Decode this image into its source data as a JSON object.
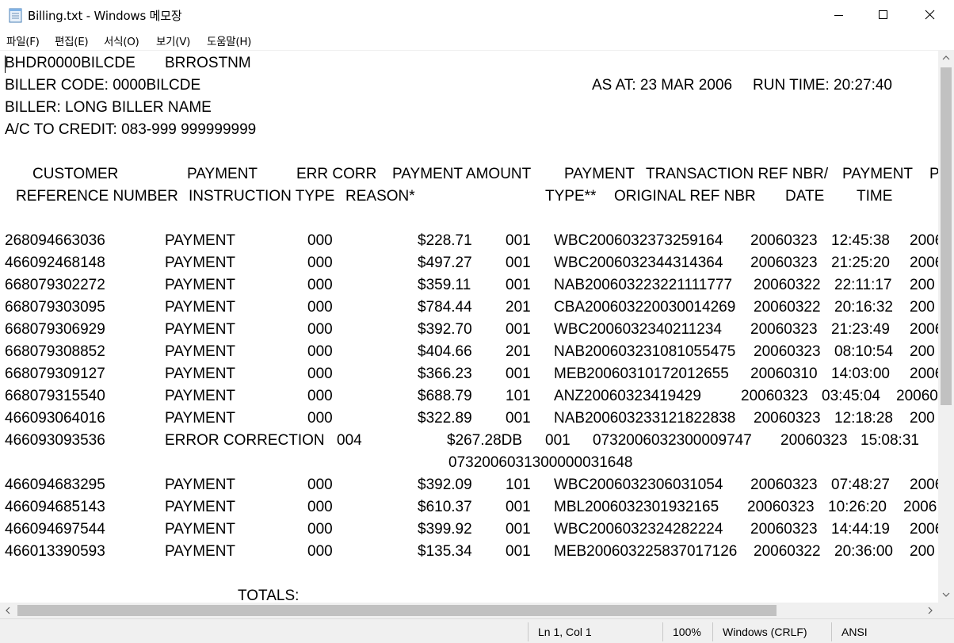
{
  "window": {
    "title": "Billing.txt - Windows 메모장",
    "icon": "notepad-icon"
  },
  "menu": [
    "파일(F)",
    "편집(E)",
    "서식(O)",
    "보기(V)",
    "도움말(H)"
  ],
  "document": {
    "header": {
      "line1_code": "BHDR0000BILCDE",
      "line1_name": "BRROSTNM",
      "biller_code": "BILLER CODE: 0000BILCDE",
      "as_at": "AS AT: 23 MAR 2006",
      "run_time": "RUN TIME: 20:27:40",
      "biller": "BILLER: LONG BILLER NAME",
      "credit": "A/C TO CREDIT: 083-999 999999999"
    },
    "column_headers": {
      "row1": [
        "CUSTOMER",
        "PAYMENT",
        "ERR CORR",
        "PAYMENT AMOUNT",
        "PAYMENT",
        "TRANSACTION REF NBR/",
        "PAYMENT",
        "P"
      ],
      "row2": [
        "REFERENCE NUMBER",
        "INSTRUCTION TYPE",
        "REASON*",
        "TYPE**",
        "ORIGINAL REF NBR",
        "DATE",
        "TIME"
      ]
    },
    "rows": [
      {
        "ref": "268094663036",
        "instr": "PAYMENT",
        "err": "000",
        "amount": "$228.71",
        "ptype": "001",
        "txn": "WBC2006032373259164",
        "date": "20060323",
        "time": "12:45:38",
        "tail": "2006"
      },
      {
        "ref": "466092468148",
        "instr": "PAYMENT",
        "err": "000",
        "amount": "$497.27",
        "ptype": "001",
        "txn": "WBC2006032344314364",
        "date": "20060323",
        "time": "21:25:20",
        "tail": "2006"
      },
      {
        "ref": "668079302272",
        "instr": "PAYMENT",
        "err": "000",
        "amount": "$359.11",
        "ptype": "001",
        "txn": "NAB200603223221111777",
        "date": "20060322",
        "time": "22:11:17",
        "tail": "200"
      },
      {
        "ref": "668079303095",
        "instr": "PAYMENT",
        "err": "000",
        "amount": "$784.44",
        "ptype": "201",
        "txn": "CBA200603220030014269",
        "date": "20060322",
        "time": "20:16:32",
        "tail": "200"
      },
      {
        "ref": "668079306929",
        "instr": "PAYMENT",
        "err": "000",
        "amount": "$392.70",
        "ptype": "001",
        "txn": "WBC2006032340211234",
        "date": "20060323",
        "time": "21:23:49",
        "tail": "2006"
      },
      {
        "ref": "668079308852",
        "instr": "PAYMENT",
        "err": "000",
        "amount": "$404.66",
        "ptype": "201",
        "txn": "NAB200603231081055475",
        "date": "20060323",
        "time": "08:10:54",
        "tail": "200"
      },
      {
        "ref": "668079309127",
        "instr": "PAYMENT",
        "err": "000",
        "amount": "$366.23",
        "ptype": "001",
        "txn": "MEB20060310172012655",
        "date": "20060310",
        "time": "14:03:00",
        "tail": "2006"
      },
      {
        "ref": "668079315540",
        "instr": "PAYMENT",
        "err": "000",
        "amount": "$688.79",
        "ptype": "101",
        "txn": "ANZ20060323419429",
        "date": "20060323",
        "time": "03:45:04",
        "tail": "20060"
      },
      {
        "ref": "466093064016",
        "instr": "PAYMENT",
        "err": "000",
        "amount": "$322.89",
        "ptype": "001",
        "txn": "NAB200603233121822838",
        "date": "20060323",
        "time": "12:18:28",
        "tail": "200"
      }
    ],
    "error_row": {
      "ref": "466093093536",
      "instr": "ERROR CORRECTION",
      "err": "004",
      "amount": "$267.28DB",
      "ptype": "001",
      "txn": "0732006032300009747",
      "date": "20060323",
      "time": "15:08:31",
      "orig": "0732006031300000031648"
    },
    "rows2": [
      {
        "ref": "466094683295",
        "instr": "PAYMENT",
        "err": "000",
        "amount": "$392.09",
        "ptype": "101",
        "txn": "WBC2006032306031054",
        "date": "20060323",
        "time": "07:48:27",
        "tail": "2006"
      },
      {
        "ref": "466094685143",
        "instr": "PAYMENT",
        "err": "000",
        "amount": "$610.37",
        "ptype": "001",
        "txn": "MBL2006032301932165",
        "date": "20060323",
        "time": "10:26:20",
        "tail": "2006"
      },
      {
        "ref": "466094697544",
        "instr": "PAYMENT",
        "err": "000",
        "amount": "$399.92",
        "ptype": "001",
        "txn": "WBC2006032324282224",
        "date": "20060323",
        "time": "14:44:19",
        "tail": "2006"
      },
      {
        "ref": "466013390593",
        "instr": "PAYMENT",
        "err": "000",
        "amount": "$135.34",
        "ptype": "001",
        "txn": "MEB200603225837017126",
        "date": "20060322",
        "time": "20:36:00",
        "tail": "200"
      }
    ],
    "totals": "TOTALS:"
  },
  "status": {
    "position": "Ln 1, Col 1",
    "zoom": "100%",
    "line_ending": "Windows (CRLF)",
    "encoding": "ANSI"
  }
}
